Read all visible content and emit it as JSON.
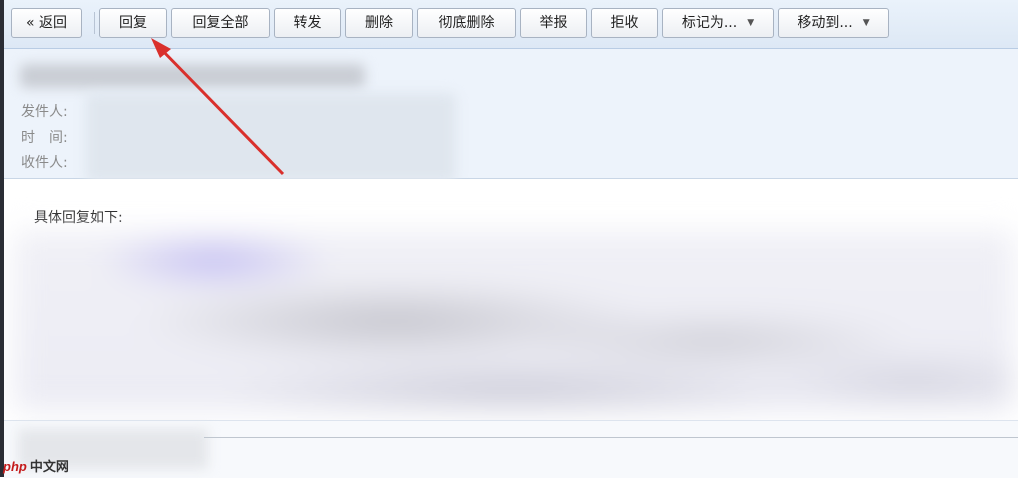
{
  "toolbar": {
    "back": "« 返回",
    "reply": "回复",
    "reply_all": "回复全部",
    "forward": "转发",
    "delete": "删除",
    "delete_permanently": "彻底删除",
    "report": "举报",
    "reject": "拒收",
    "mark_as": "标记为...",
    "move_to": "移动到..."
  },
  "header": {
    "sender_label": "发件人:",
    "time_label": "时　间:",
    "recipient_label": "收件人:"
  },
  "body": {
    "intro": "具体回复如下:"
  },
  "annotation": {
    "arrow_color": "#d9302c"
  },
  "watermark": {
    "brand": "php",
    "site": "中文网"
  }
}
